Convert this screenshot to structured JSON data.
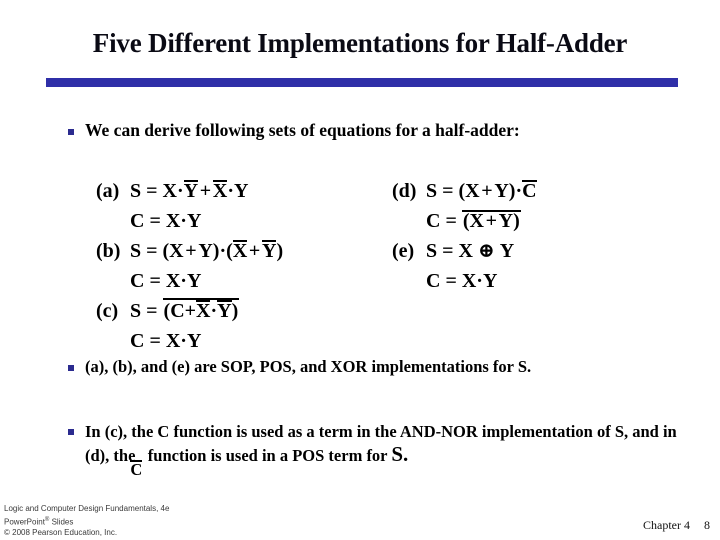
{
  "slide": {
    "title": "Five Different Implementations for Half-Adder",
    "accent_color": "#2f2fa8",
    "bullet_color": "#2b2b8f"
  },
  "bullets": {
    "intro": "We can derive following sets of equations for a half-adder:",
    "note_sop": "(a), (b), and (e) are SOP, POS, and XOR implementations for S.",
    "note_c_part1": "In (c), the C function is used as a term in the AND-NOR implementation of S, and in (d), the",
    "note_c_overlap": "C",
    "note_c_part2": "function is used in a POS term for",
    "note_c_tail": "S."
  },
  "equations": {
    "left": [
      {
        "label": "(a)",
        "lhs": "S",
        "terms": [
          "X",
          "·",
          "Y",
          "+",
          "X",
          "·",
          "Y"
        ],
        "text": "S = X·Ȳ + X̄·Y"
      },
      {
        "label": "",
        "lhs": "C",
        "text": "C = X·Y"
      },
      {
        "label": "(b)",
        "lhs": "S",
        "text": "S = (X + Y)·(X̄ + Ȳ)"
      },
      {
        "label": "",
        "lhs": "C",
        "text": "C = X·Y"
      },
      {
        "label": "(c)",
        "lhs": "S",
        "text": "S = (C + X̄·Ȳ)̄"
      },
      {
        "label": "",
        "lhs": "C",
        "text": "C = X·Y"
      }
    ],
    "right": [
      {
        "label": "(d)",
        "lhs": "S",
        "text": "S = (X + Y)·C̄"
      },
      {
        "label": "",
        "lhs": "C",
        "text": "C = (X + Y)̄"
      },
      {
        "label": "(e)",
        "lhs": "S",
        "text": "S = X ⊕ Y"
      },
      {
        "label": "",
        "lhs": "C",
        "text": "C = X·Y"
      }
    ],
    "symbols": {
      "and": "·",
      "or": "+",
      "xor": "⊕",
      "label_a": "(a)",
      "label_b": "(b)",
      "label_c": "(c)",
      "label_d": "(d)",
      "label_e": "(e)",
      "var_x": "X",
      "var_y": "Y",
      "var_s": "S",
      "var_c": "C",
      "eq": "="
    }
  },
  "footer": {
    "line1": "Logic and Computer Design Fundamentals, 4e",
    "line2_a": "PowerPoint",
    "line2_sup": "®",
    "line2_b": " Slides",
    "line3": "© 2008 Pearson Education, Inc.",
    "chapter": "Chapter 4",
    "page": "8"
  }
}
